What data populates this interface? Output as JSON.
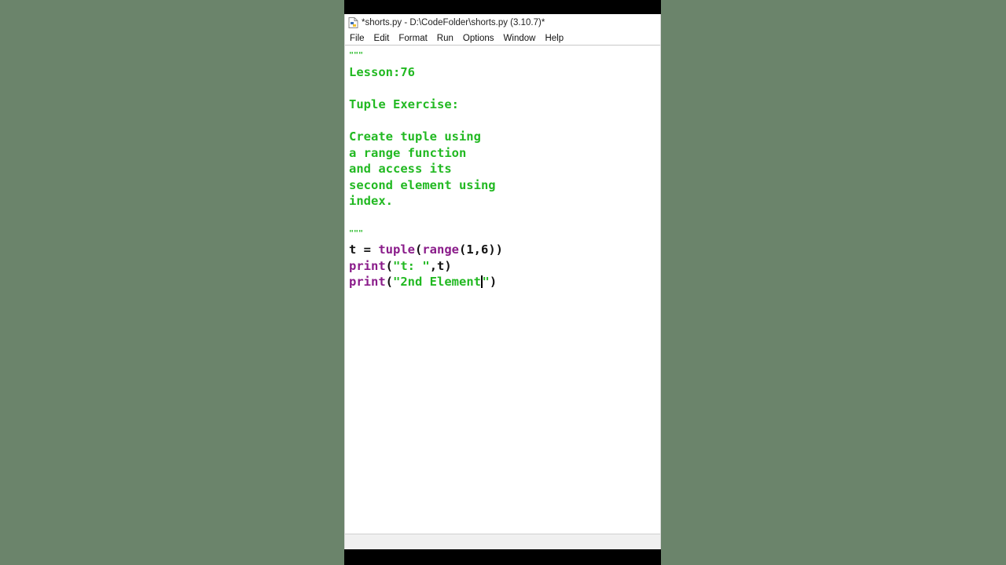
{
  "window": {
    "title": "*shorts.py - D:\\CodeFolder\\shorts.py (3.10.7)*",
    "icon": "python-file-icon"
  },
  "menu": {
    "items": [
      "File",
      "Edit",
      "Format",
      "Run",
      "Options",
      "Window",
      "Help"
    ]
  },
  "editor": {
    "docstring_open": "\"\"\"",
    "lesson": "Lesson:76",
    "heading": "Tuple Exercise:",
    "desc1": "Create tuple using",
    "desc2": "a range function",
    "desc3": "and access its",
    "desc4": "second element using",
    "desc5": "index.",
    "docstring_close": "\"\"\"",
    "code1": {
      "a": "t = ",
      "b": "tuple",
      "c": "(",
      "d": "range",
      "e": "(1,6))"
    },
    "code2": {
      "a": "print",
      "b": "(",
      "c": "\"t: \"",
      "d": ",t)"
    },
    "code3": {
      "a": "print",
      "b": "(",
      "c": "\"2nd Element",
      "d": "\"",
      "e": ")"
    }
  },
  "colors": {
    "string": "#22b922",
    "builtin": "#8a1c8a",
    "background": "#6b846b"
  }
}
